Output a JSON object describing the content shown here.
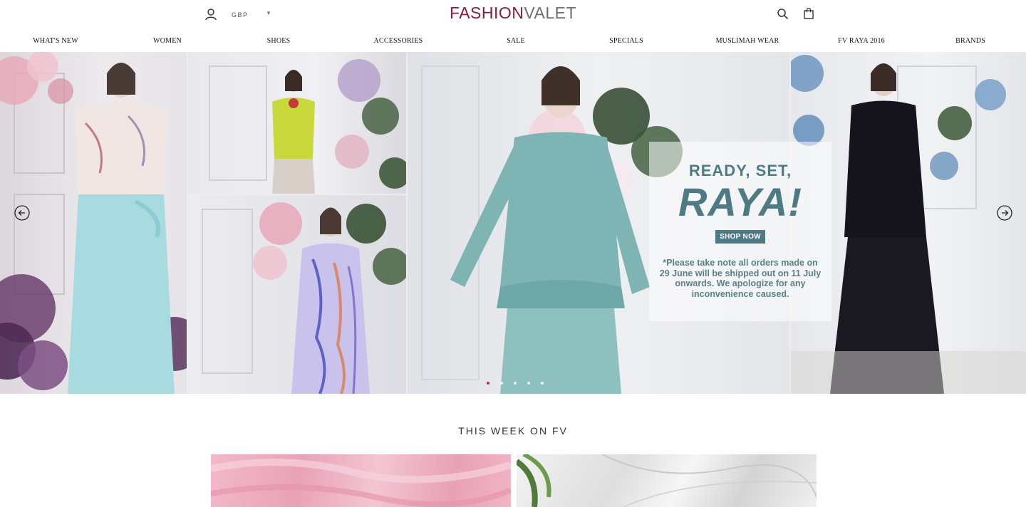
{
  "header": {
    "logo_part1": "FASHION",
    "logo_part2": "VALET",
    "currency": "GBP",
    "currency_caret": "▼"
  },
  "nav": {
    "items": [
      {
        "label": "What's New"
      },
      {
        "label": "Women"
      },
      {
        "label": "Shoes"
      },
      {
        "label": "Accessories"
      },
      {
        "label": "Sale"
      },
      {
        "label": "Specials"
      },
      {
        "label": "Muslimah Wear"
      },
      {
        "label": "FV Raya 2016"
      },
      {
        "label": "Brands"
      }
    ]
  },
  "hero": {
    "promo_line1": "READY, SET,",
    "promo_line2": "RAYA!",
    "promo_button": "SHOP NOW",
    "promo_note": "*Please take note all orders made on 29 June will be shipped out on 11 July onwards. We apologize for any inconvenience caused.",
    "slide_count": 5,
    "active_slide": 1
  },
  "section": {
    "title": "THIS WEEK ON FV"
  },
  "colors": {
    "brand": "#8d1c3d",
    "promo_teal": "#4e7b83",
    "active_dot": "#c03040"
  }
}
